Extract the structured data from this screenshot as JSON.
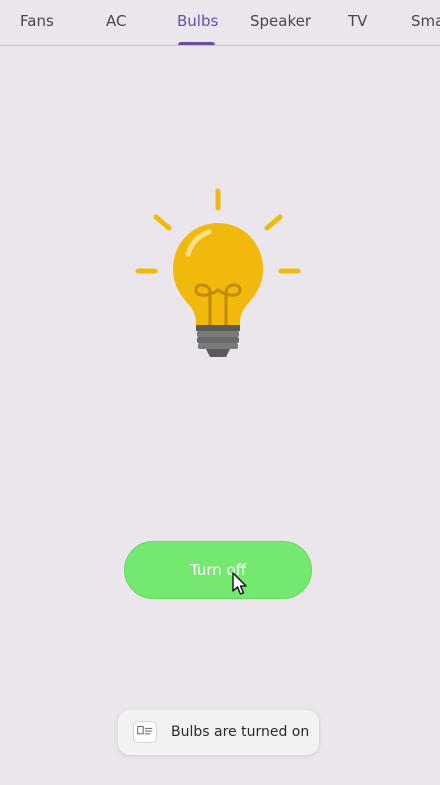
{
  "tabs": [
    {
      "label": "Fans",
      "active": false
    },
    {
      "label": "AC",
      "active": false
    },
    {
      "label": "Bulbs",
      "active": true
    },
    {
      "label": "Speaker",
      "active": false
    },
    {
      "label": "TV",
      "active": false
    },
    {
      "label": "Sma",
      "active": false
    }
  ],
  "bulb": {
    "icon": "lightbulb-icon",
    "state": "on",
    "glass_color": "#f2b90d",
    "base_color": "#6b6b6b"
  },
  "button": {
    "label": "Turn off",
    "color": "#75e86f"
  },
  "toast": {
    "icon": "app-icon",
    "message": "Bulbs are turned on"
  },
  "colors": {
    "accent": "#6750a4",
    "background": "#ebe5ec"
  }
}
